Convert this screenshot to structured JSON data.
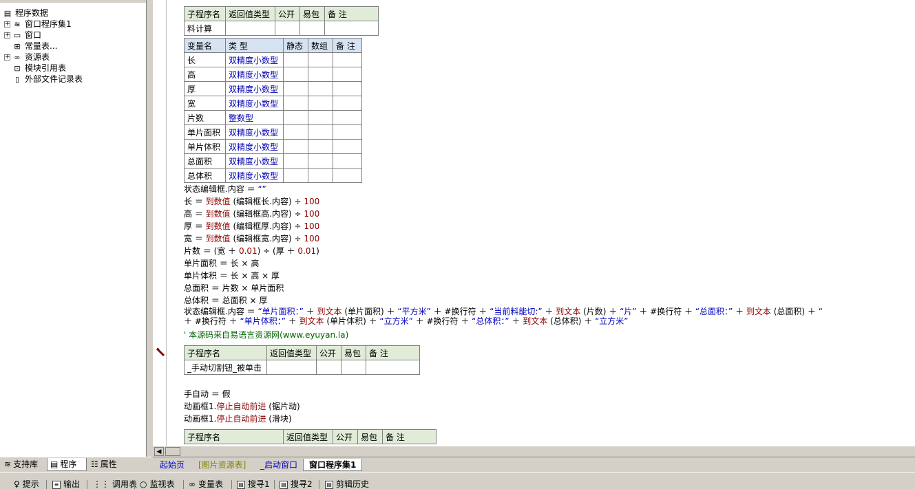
{
  "tree": {
    "root": "程序数据",
    "items": [
      {
        "label": "窗口程序集1",
        "icon": "layers-icon",
        "expandable": true
      },
      {
        "label": "窗口",
        "icon": "window-icon",
        "expandable": true
      },
      {
        "label": "常量表...",
        "icon": "constants-icon",
        "expandable": false
      },
      {
        "label": "资源表",
        "icon": "resources-icon",
        "expandable": true
      },
      {
        "label": "模块引用表",
        "icon": "module-icon",
        "expandable": false
      },
      {
        "label": "外部文件记录表",
        "icon": "file-record-icon",
        "expandable": false
      }
    ]
  },
  "left_tabs": [
    {
      "label": "支持库",
      "icon": "library-icon"
    },
    {
      "label": "程序",
      "icon": "program-icon",
      "active": true
    },
    {
      "label": "属性",
      "icon": "properties-icon"
    }
  ],
  "sub_header": [
    "子程序名",
    "返回值类型",
    "公开",
    "易包",
    "备 注"
  ],
  "sub1": {
    "name": "料计算"
  },
  "var_header": [
    "变量名",
    "类 型",
    "静态",
    "数组",
    "备 注"
  ],
  "vars": [
    {
      "name": "长",
      "type": "双精度小数型"
    },
    {
      "name": "高",
      "type": "双精度小数型"
    },
    {
      "name": "厚",
      "type": "双精度小数型"
    },
    {
      "name": "宽",
      "type": "双精度小数型"
    },
    {
      "name": "片数",
      "type": "整数型"
    },
    {
      "name": "单片面积",
      "type": "双精度小数型"
    },
    {
      "name": "单片体积",
      "type": "双精度小数型"
    },
    {
      "name": "总面积",
      "type": "双精度小数型"
    },
    {
      "name": "总体积",
      "type": "双精度小数型"
    }
  ],
  "code1": {
    "l1a": "状态编辑框.内容 ＝ ",
    "l1b": "“”",
    "l2a": "长 ＝ ",
    "l2b": "到数值",
    "l2c": " (编辑框长.内容) ÷ ",
    "l2d": "100",
    "l3a": "高 ＝ ",
    "l3b": "到数值",
    "l3c": " (编辑框高.内容) ÷ ",
    "l3d": "100",
    "l4a": "厚 ＝ ",
    "l4b": "到数值",
    "l4c": " (编辑框厚.内容) ÷ ",
    "l4d": "100",
    "l5a": "宽 ＝ ",
    "l5b": "到数值",
    "l5c": " (编辑框宽.内容) ÷ ",
    "l5d": "100",
    "l6a": "片数 ＝ (宽 ＋ ",
    "l6b": "0.01",
    "l6c": ") ÷ (厚 ＋ ",
    "l6d": "0.01",
    "l6e": ")",
    "l7": "单片面积 ＝ 长 × 高",
    "l8": "单片体积 ＝ 长 × 高 × 厚",
    "l9": "总面积 ＝ 片数 × 单片面积",
    "l10": "总体积 ＝ 总面积 × 厚",
    "l11a": "状态编辑框.内容 ＝ ",
    "l11b": "“单片面积：”",
    "l11c": " ＋ ",
    "l11d": "到文本",
    "l11e": " (单片面积) ＋ ",
    "l11f": "“平方米”",
    "l11g": " ＋ #换行符 ＋ ",
    "l11h": "“当前料能切:”",
    "l11i": " ＋ ",
    "l11j": "到文本",
    "l11k": " (片数) ＋ ",
    "l11l": "“片”",
    "l11m": " ＋ #换行符 ＋ ",
    "l11n": "“总面积：”",
    "l11o": " ＋ ",
    "l11p": "到文本",
    "l11q": " (总面积) ＋ ",
    "l11r": "“",
    "l12a": "＋ #换行符 ＋ ",
    "l12b": "“单片体积：”",
    "l12c": " ＋ ",
    "l12d": "到文本",
    "l12e": " (单片体积) ＋ ",
    "l12f": "“立方米”",
    "l12g": " ＋ #换行符 ＋ ",
    "l12h": "“总体积：”",
    "l12i": " ＋ ",
    "l12j": "到文本",
    "l12k": " (总体积) ＋ ",
    "l12l": "“立方米”",
    "comment": "' 本源码来自易语言资源网(www.eyuyan.la)"
  },
  "sub2": {
    "name": "_手动切割钮_被单击"
  },
  "code2": {
    "l1": "手自动 ＝ 假",
    "l2a": "动画框1.",
    "l2b": "停止自动前进",
    "l2c": " (锯片动)",
    "l3a": "动画框1.",
    "l3b": "停止自动前进",
    "l3c": " (滑块)"
  },
  "doc_tabs": [
    {
      "label": "起始页",
      "color": "#0000c0"
    },
    {
      "label": "[图片资源表]",
      "color": "#808000"
    },
    {
      "label": "_启动窗口",
      "color": "#0000c0"
    },
    {
      "label": "窗口程序集1",
      "color": "#000000",
      "active": true
    }
  ],
  "bottom_tabs": [
    {
      "label": "提示",
      "icon": "hint-icon"
    },
    {
      "label": "输出",
      "icon": "output-icon"
    },
    {
      "label": "调用表",
      "icon": "call-table-icon"
    },
    {
      "label": "监视表",
      "icon": "watch-icon"
    },
    {
      "label": "变量表",
      "icon": "variables-icon"
    },
    {
      "label": "搜寻1",
      "icon": "search1-icon"
    },
    {
      "label": "搜寻2",
      "icon": "search2-icon"
    },
    {
      "label": "剪辑历史",
      "icon": "clip-history-icon"
    }
  ]
}
